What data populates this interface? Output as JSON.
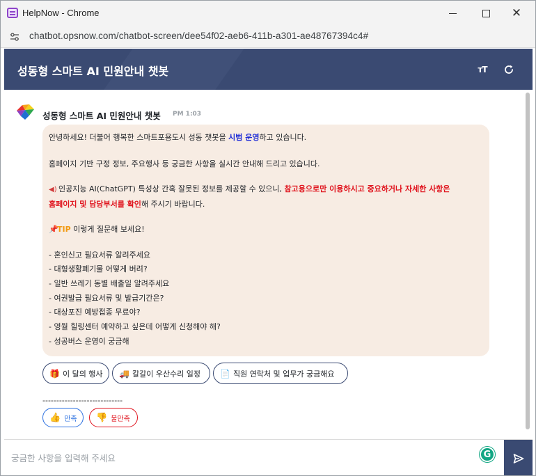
{
  "window": {
    "title": "HelpNow - Chrome",
    "url": "chatbot.opsnow.com/chatbot-screen/dee54f02-aeb6-411b-a301-ae48767394c4#"
  },
  "header": {
    "title": "성동형 스마트 AI 민원안내 챗봇",
    "font_size_label": "тT"
  },
  "message": {
    "sender": "성동형 스마트 AI 민원안내 챗봇",
    "time": "PM 1:03",
    "greeting_pre": "안녕하세요! 더불어 행복한 스마트포용도시 성동 챗봇을 ",
    "greeting_highlight": "시범 운영",
    "greeting_post": "하고 있습니다.",
    "intro": "홈페이지 기반 구정 정보, 주요행사 등 궁금한 사항을 실시간 안내해 드리고 있습니다.",
    "warning_pre": "인공지능 AI(ChatGPT) 특성상 간혹 잘못된 정보를 제공할 수 있으니, ",
    "warning_red_1": "참고용으로만 이용하시고 중요하거나 자세한 사항은",
    "warning_red_2": "홈페이지 및 담당부서를 확인",
    "warning_post": "해 주시기 바랍니다.",
    "tip_label": "TIP",
    "tip_text": " 이렇게 질문해 보세요!",
    "examples": [
      "- 혼인신고 필요서류 알려주세요",
      "- 대형생활폐기물 어떻게 버려?",
      "- 일반 쓰레기 동별 배출일 알려주세요",
      "- 여권발급 필요서류 및 발급기간은?",
      "- 대상포진 예방접종 무료야?",
      "- 영월 힐링센터 예약하고 싶은데 어떻게 신청해야 해?",
      "- 성공버스 운영이 궁금해"
    ]
  },
  "quick_replies": [
    {
      "label": "이 달의 행사",
      "icon": "gift-icon"
    },
    {
      "label": "칼갈이 우산수리 일정",
      "icon": "truck-icon"
    },
    {
      "label": "직원 연락처 및 업무가 궁금해요",
      "icon": "document-icon"
    }
  ],
  "divider": "-----------------------------",
  "feedback": {
    "like_label": "만족",
    "dislike_label": "불만족"
  },
  "input": {
    "placeholder": "궁금한 사항을 입력해 주세요",
    "value": ""
  },
  "colors": {
    "header_bg": "#3a4a72",
    "bubble_bg": "#f7ece3",
    "highlight_blue": "#1d2bd6",
    "warning_red": "#e0141e",
    "tip_orange": "#f29a13",
    "like_blue": "#2a6fe0"
  }
}
